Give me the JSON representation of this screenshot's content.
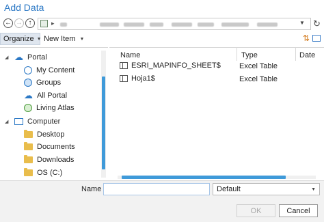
{
  "window": {
    "title": "Add Data"
  },
  "toolbar": {
    "organize_label": "Organize",
    "new_item_label": "New Item"
  },
  "tree": {
    "portal": "Portal",
    "my_content": "My Content",
    "groups": "Groups",
    "all_portal": "All Portal",
    "living_atlas": "Living Atlas",
    "computer": "Computer",
    "desktop": "Desktop",
    "documents": "Documents",
    "downloads": "Downloads",
    "os_c": "OS (C:)"
  },
  "columns": {
    "name": "Name",
    "type": "Type",
    "date": "Date"
  },
  "files": [
    {
      "name": "ESRI_MAPINFO_SHEET$",
      "type": "Excel Table"
    },
    {
      "name": "Hoja1$",
      "type": "Excel Table"
    }
  ],
  "footer": {
    "name_label": "Name",
    "name_value": "",
    "filter_value": "Default",
    "ok_label": "OK",
    "cancel_label": "Cancel"
  },
  "icons": {
    "back": "back-arrow-icon",
    "forward": "forward-arrow-icon",
    "up": "up-arrow-icon",
    "refresh": "refresh-icon",
    "sort": "sort-icon",
    "view": "view-options-icon",
    "folder": "folder-icon",
    "table": "table-icon"
  },
  "colors": {
    "accent": "#2b78c5",
    "scroll_thumb": "#3f9ad9",
    "toolbar_selected": "#dfe6ef",
    "folder": "#e9bd4c"
  }
}
